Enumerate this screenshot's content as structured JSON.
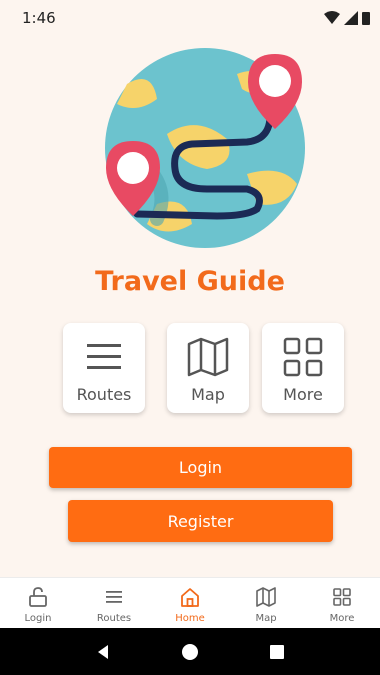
{
  "status": {
    "time": "1:46"
  },
  "app": {
    "title": "Travel Guide"
  },
  "tiles": [
    {
      "label": "Routes",
      "icon": "menu-icon"
    },
    {
      "label": "Map",
      "icon": "map-icon"
    },
    {
      "label": "More",
      "icon": "grid-icon"
    }
  ],
  "buttons": {
    "login": "Login",
    "register": "Register"
  },
  "nav": [
    {
      "label": "Login",
      "icon": "unlock-icon"
    },
    {
      "label": "Routes",
      "icon": "menu-icon"
    },
    {
      "label": "Home",
      "icon": "home-icon",
      "active": true
    },
    {
      "label": "Map",
      "icon": "map-icon"
    },
    {
      "label": "More",
      "icon": "grid-icon"
    }
  ],
  "colors": {
    "accent": "#f26a1b",
    "button": "#ff6c12",
    "background": "#fdf5ef"
  }
}
